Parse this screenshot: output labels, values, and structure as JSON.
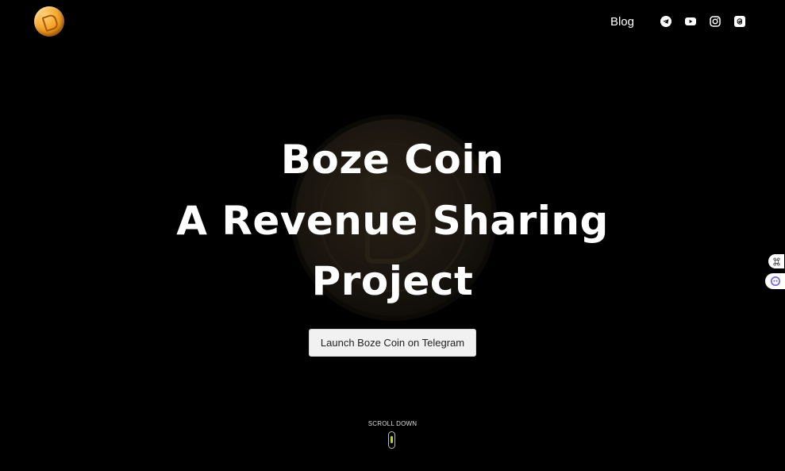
{
  "header": {
    "logo_icon": "boze-coin-logo-icon",
    "nav": {
      "blog_label": "Blog",
      "icons": [
        "telegram-icon",
        "youtube-icon",
        "instagram-icon",
        "threads-icon"
      ]
    }
  },
  "hero": {
    "title_line1": "Boze Coin",
    "title_line2": "A Revenue Sharing",
    "title_line3": "Project",
    "cta_label": "Launch Boze Coin on Telegram"
  },
  "scroll": {
    "label": "SCROLL DOWN"
  },
  "side_widgets": [
    "command-icon",
    "assistant-icon"
  ],
  "colors": {
    "background": "#000000",
    "text": "#ffffff",
    "button_bg": "#f1f1f1",
    "coin_gold": "#f4a52a",
    "scroll_accent": "#b8d43a"
  }
}
